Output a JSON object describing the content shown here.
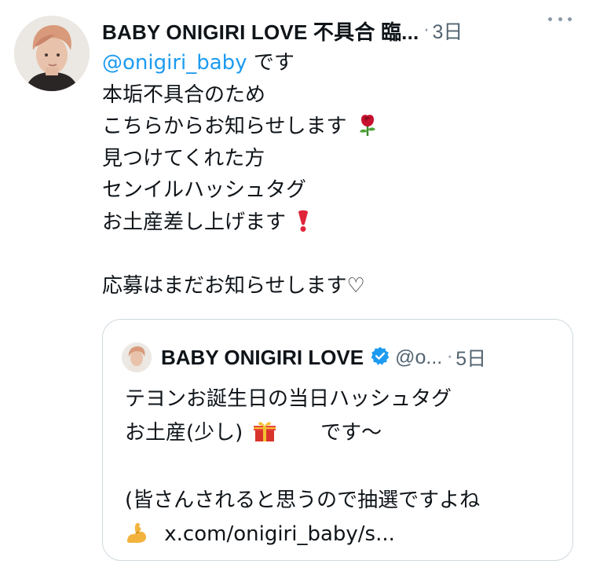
{
  "tweet": {
    "display_name": "BABY ONIGIRI LOVE 不具合 臨...",
    "separator": "·",
    "time": "3日",
    "more_icon": "more-horizontal-icon",
    "mention": "@onigiri_baby",
    "lines": [
      "です",
      "本垢不具合のため",
      "こちらからお知らせします",
      "見つけてくれた方",
      "センイルハッシュタグ",
      "お土産差し上げます",
      "",
      "応募はまだお知らせします♡"
    ],
    "emojis": {
      "rose": "rose-emoji",
      "exclamation": "heavy-exclamation-emoji"
    }
  },
  "quote": {
    "display_name": "BABY ONIGIRI LOVE",
    "verified_icon": "verified-badge-icon",
    "handle": "@o...",
    "separator": "·",
    "time": "5日",
    "lines": [
      "テヨンお誕生日の当日ハッシュタグ",
      "お土産(少し)",
      "です〜",
      "",
      "(皆さんされると思うので抽選ですよね",
      "x.com/onigiri_baby/s..."
    ],
    "emojis": {
      "gift": "gift-emoji",
      "muscle": "flexed-biceps-emoji"
    }
  }
}
